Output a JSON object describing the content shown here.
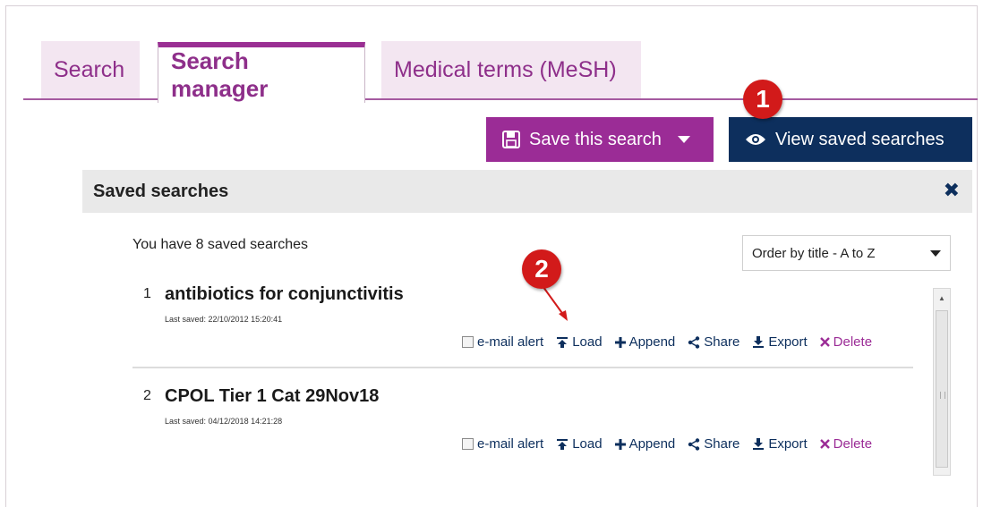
{
  "tabs": [
    {
      "label": "Search"
    },
    {
      "label": "Search manager"
    },
    {
      "label": "Medical terms (MeSH)"
    }
  ],
  "toolbar": {
    "save_label": "Save this search",
    "view_label": "View saved searches"
  },
  "markers": [
    "1",
    "2"
  ],
  "panel": {
    "title": "Saved searches",
    "close": "✖",
    "count_text": "You have 8 saved searches",
    "order_value": "Order by title - A to Z"
  },
  "results": [
    {
      "num": "1",
      "title": "antibiotics for conjunctivitis",
      "saved": "Last saved: 22/10/2012 15:20:41"
    },
    {
      "num": "2",
      "title": "CPOL Tier 1 Cat 29Nov18",
      "saved": "Last saved: 04/12/2018 14:21:28"
    }
  ],
  "actions": {
    "email": "e-mail alert",
    "load": "Load",
    "append": "Append",
    "share": "Share",
    "export": "Export",
    "delete": "Delete"
  },
  "colors": {
    "accent": "#9b2c96",
    "navy": "#0d2f5d",
    "marker": "#d21a1a"
  }
}
